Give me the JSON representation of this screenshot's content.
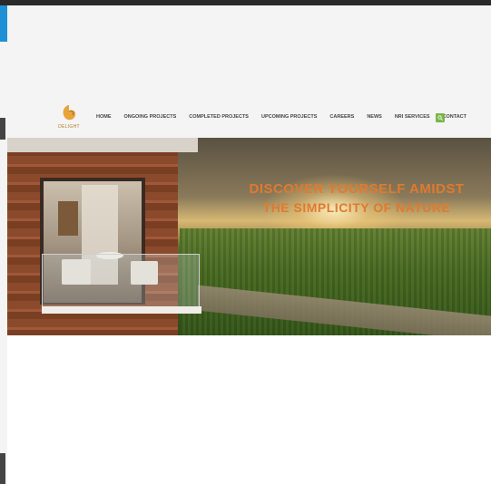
{
  "logo": {
    "text": "DELIGHT"
  },
  "nav": {
    "items": [
      {
        "label": "HOME"
      },
      {
        "label": "ONGOING PROJECTS"
      },
      {
        "label": "COMPLETED PROJECTS"
      },
      {
        "label": "UPCOMING PROJECTS"
      },
      {
        "label": "CAREERS"
      },
      {
        "label": "NEWS"
      },
      {
        "label": "NRI SERVICES"
      },
      {
        "label": "CONTACT"
      }
    ]
  },
  "hero": {
    "headline_line1": "DISCOVER YOURSELF AMIDST",
    "headline_line2": "THE SIMPLICITY OF NATURE"
  },
  "colors": {
    "accent": "#e07a2e",
    "search": "#7ab648"
  },
  "icons": {
    "search": "search-icon"
  }
}
